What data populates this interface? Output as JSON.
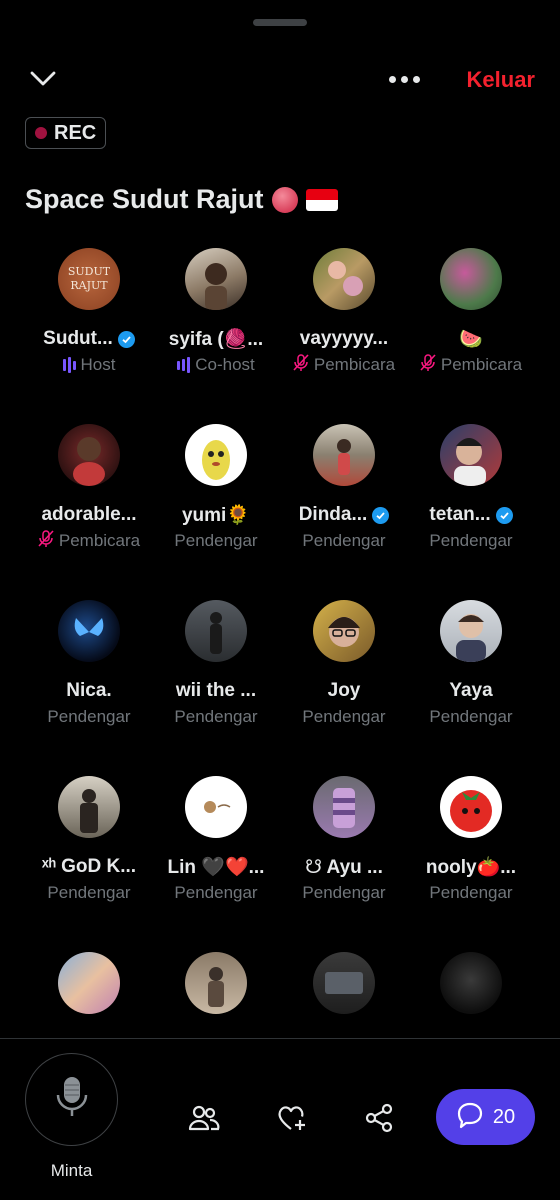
{
  "header": {
    "collapse_icon": "chevron-down-icon",
    "more_icon": "more-horizontal-icon",
    "leave_label": "Keluar",
    "leave_color": "#f4212e"
  },
  "recording": {
    "label": "REC"
  },
  "space": {
    "title": "Space Sudut Rajut"
  },
  "participants": [
    {
      "name": "Sudut...",
      "role": "Host",
      "verified": true,
      "role_icon": "speaking-bars-icon"
    },
    {
      "name": "syifa (🧶...",
      "role": "Co-host",
      "verified": false,
      "role_icon": "speaking-bars-icon"
    },
    {
      "name": "vayyyyy...",
      "role": "Pembicara",
      "verified": false,
      "role_icon": "mic-off-icon"
    },
    {
      "name": "🍉",
      "role": "Pembicara",
      "verified": false,
      "role_icon": "mic-off-icon"
    },
    {
      "name": "adorable...",
      "role": "Pembicara",
      "verified": false,
      "role_icon": "mic-off-icon"
    },
    {
      "name": "yumi🌻",
      "role": "Pendengar",
      "verified": false
    },
    {
      "name": "Dinda...",
      "role": "Pendengar",
      "verified": true
    },
    {
      "name": "tetan...",
      "role": "Pendengar",
      "verified": true
    },
    {
      "name": "Nica.",
      "role": "Pendengar",
      "verified": false
    },
    {
      "name": "wii the ...",
      "role": "Pendengar",
      "verified": false
    },
    {
      "name": "Joy",
      "role": "Pendengar",
      "verified": false
    },
    {
      "name": "Yaya",
      "role": "Pendengar",
      "verified": false
    },
    {
      "name": "ˣʰ GoD K...",
      "role": "Pendengar",
      "verified": false
    },
    {
      "name": "Lin 🖤❤️...",
      "role": "Pendengar",
      "verified": false
    },
    {
      "name": "☋ Ayu ...",
      "role": "Pendengar",
      "verified": false
    },
    {
      "name": "nooly🍅...",
      "role": "Pendengar",
      "verified": false
    },
    {
      "name": "",
      "role": "",
      "verified": false
    },
    {
      "name": "",
      "role": "",
      "verified": false
    },
    {
      "name": "",
      "role": "",
      "verified": false
    },
    {
      "name": "",
      "role": "",
      "verified": false
    }
  ],
  "bottom_bar": {
    "mic_label": "Minta",
    "mic_icon": "microphone-icon",
    "people_icon": "people-icon",
    "react_icon": "heart-plus-icon",
    "share_icon": "share-icon",
    "comments_icon": "comment-icon",
    "comments_count": "20",
    "accent": "#5340e8"
  }
}
